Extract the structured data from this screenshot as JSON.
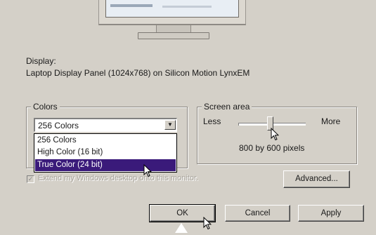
{
  "display": {
    "label": "Display:",
    "value": "Laptop Display Panel (1024x768) on Silicon Motion LynxEM"
  },
  "colors": {
    "legend": "Colors",
    "selected": "256 Colors",
    "options": [
      "256 Colors",
      "High Color (16 bit)",
      "True Color (24 bit)"
    ],
    "highlighted": "True Color (24 bit)"
  },
  "screen_area": {
    "legend": "Screen area",
    "less_label": "Less",
    "more_label": "More",
    "resolution_text": "800 by 600 pixels"
  },
  "extend_checkbox": {
    "label": "Extend my Windows desktop onto this monitor.",
    "checked": true,
    "enabled": false
  },
  "buttons": {
    "advanced": "Advanced...",
    "ok": "OK",
    "cancel": "Cancel",
    "apply": "Apply"
  },
  "icons": {
    "combo_arrow": "chevron-down-icon",
    "pointer": "arrow-cursor-icon"
  }
}
